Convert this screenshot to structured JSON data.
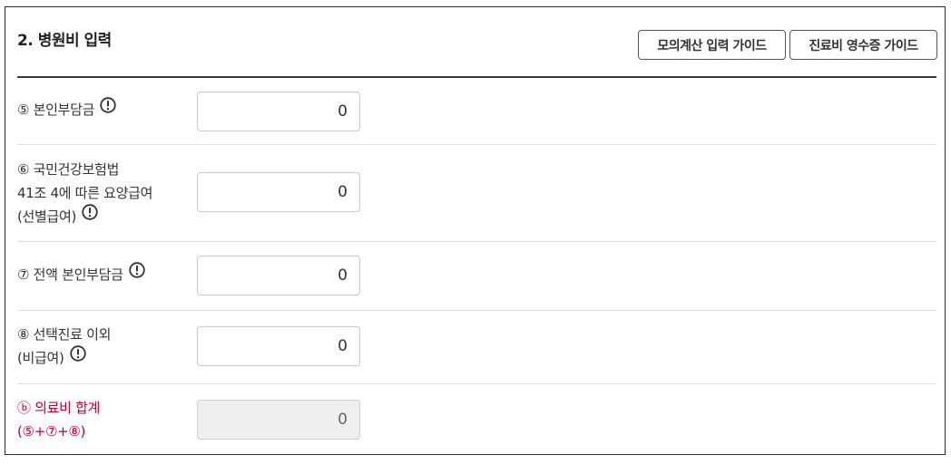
{
  "section": {
    "title": "2. 병원비 입력",
    "buttons": {
      "mock_calc_guide": "모의계산 입력 가이드",
      "receipt_guide": "진료비 영수증 가이드"
    }
  },
  "rows": [
    {
      "lines": [
        "⑤ 본인부담금"
      ],
      "has_info": true,
      "value": "0",
      "readonly": false
    },
    {
      "lines": [
        "⑥ 국민건강보험법",
        "41조 4에 따른 요양급여",
        "(선별급여)"
      ],
      "has_info": true,
      "value": "0",
      "readonly": false
    },
    {
      "lines": [
        "⑦ 전액 본인부담금"
      ],
      "has_info": true,
      "value": "0",
      "readonly": false
    },
    {
      "lines": [
        "⑧ 선택진료 이외",
        "(비급여)"
      ],
      "has_info": true,
      "value": "0",
      "readonly": false
    },
    {
      "lines": [
        "ⓑ 의료비 합계",
        "(⑤+⑦+⑧)"
      ],
      "has_info": false,
      "value": "0",
      "readonly": true
    }
  ],
  "colors": {
    "border": "#2b2b2b",
    "divider": "#dedede",
    "total_label": "#b4003c",
    "readonly_bg": "#efefef"
  },
  "icons": {
    "info": "exclamation-circle-icon"
  }
}
